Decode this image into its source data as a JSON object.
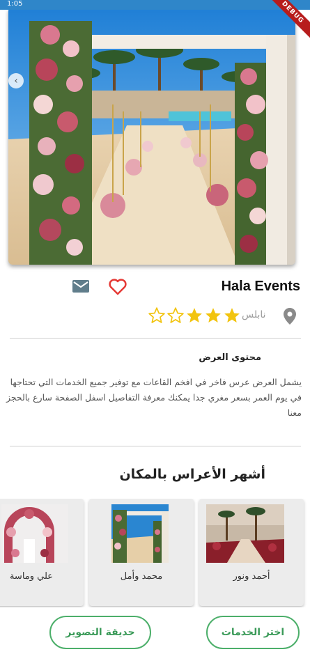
{
  "app": {
    "status_time": "1:05",
    "debug_label": "DEBUG"
  },
  "venue": {
    "name": "Hala Events",
    "city": "نابلس",
    "rating": 3,
    "rating_max": 5,
    "colors": {
      "star_filled": "#f2c40f",
      "heart": "#e53935",
      "mail": "#607d8b",
      "location": "#8a8a8a"
    }
  },
  "offer": {
    "title": "محتوى العرض",
    "body": "يشمل العرض عرس فاخر في افخم القاعات مع توفير جميع الخدمات التي تحتاجها في يوم العمر بسعر مغري جدا يمكنك معرفة التفاصيل اسفل الصفحة سارع بالحجز معنا"
  },
  "popular": {
    "title": "أشهر الأعراس بالمكان",
    "items": [
      {
        "label": "أحمد ونور"
      },
      {
        "label": "محمد وأمل"
      },
      {
        "label": "علي وماسة"
      }
    ]
  },
  "actions": {
    "choose_services": "اختر الخدمات",
    "photo_garden": "حديقة التصوير"
  },
  "theme": {
    "accent": "#3a9a58"
  }
}
